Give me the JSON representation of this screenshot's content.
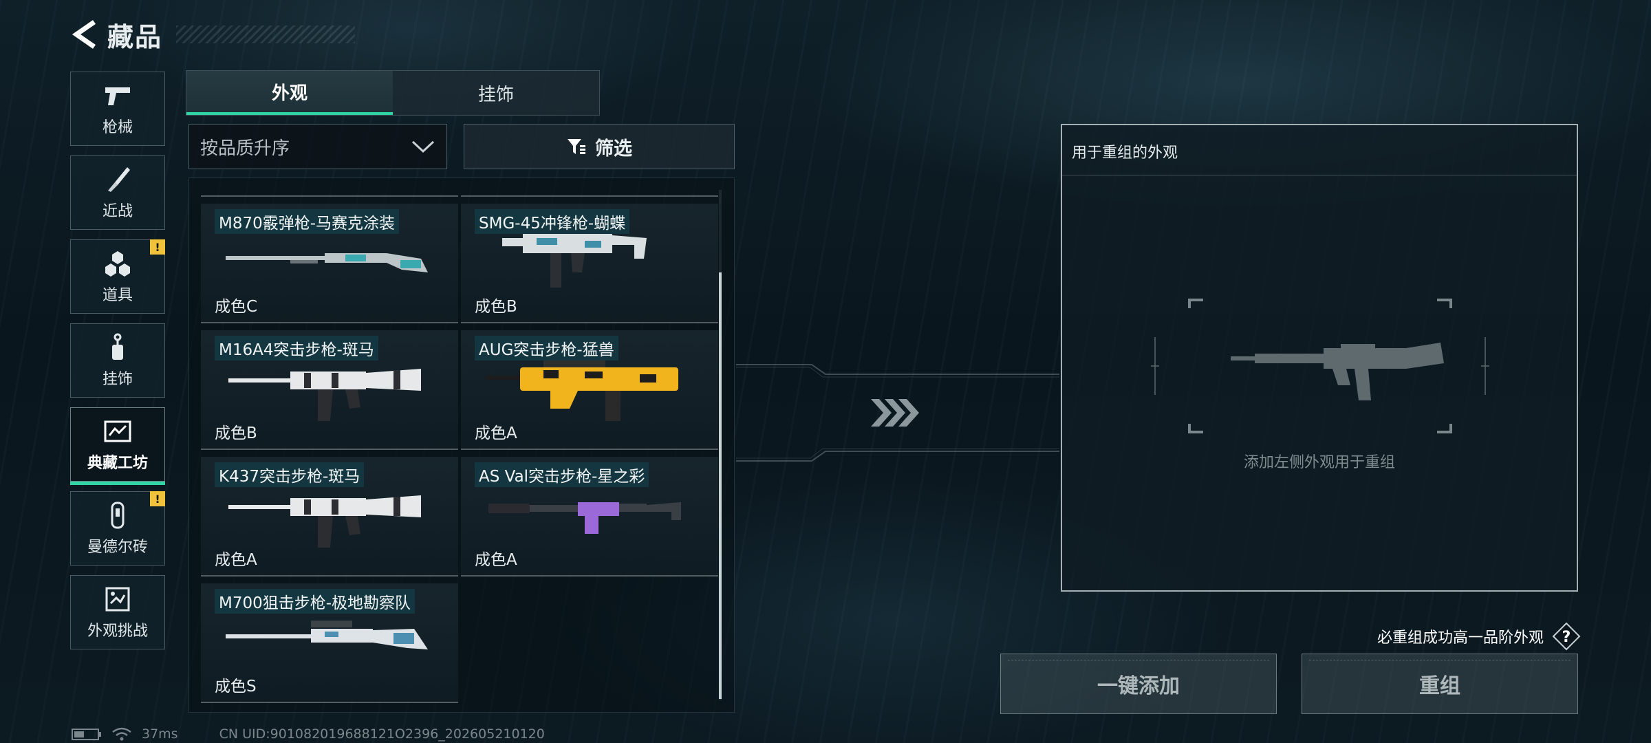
{
  "header": {
    "title": "藏品"
  },
  "nav": {
    "items": [
      {
        "label": "枪械",
        "icon": "pistol-icon",
        "badge": ""
      },
      {
        "label": "近战",
        "icon": "knife-icon",
        "badge": ""
      },
      {
        "label": "道具",
        "icon": "grenade-icon",
        "badge": "!"
      },
      {
        "label": "挂饰",
        "icon": "charm-icon",
        "badge": ""
      },
      {
        "label": "典藏工坊",
        "icon": "workshop-icon",
        "badge": ""
      },
      {
        "label": "曼德尔砖",
        "icon": "brick-icon",
        "badge": "!"
      },
      {
        "label": "外观挑战",
        "icon": "challenge-icon",
        "badge": ""
      }
    ],
    "active_index": 4
  },
  "tabs": [
    {
      "label": "外观"
    },
    {
      "label": "挂饰"
    }
  ],
  "sort": {
    "label": "按品质升序"
  },
  "filter": {
    "label": "筛选"
  },
  "items": [
    {
      "name": "M870霰弹枪-马赛克涂装",
      "grade": "成色C",
      "skin": "shotgun",
      "colors": [
        "#bcc6c9",
        "#3aa9b0"
      ]
    },
    {
      "name": "SMG-45冲锋枪-蝴蝶",
      "grade": "成色B",
      "skin": "smg",
      "colors": [
        "#d9dfe1",
        "#3f8fa8"
      ]
    },
    {
      "name": "M16A4突击步枪-斑马",
      "grade": "成色B",
      "skin": "rifle",
      "colors": [
        "#e6e8e9",
        "#2b2d30"
      ]
    },
    {
      "name": "AUG突击步枪-猛兽",
      "grade": "成色A",
      "skin": "bullpup",
      "colors": [
        "#f2b41c",
        "#1d1d1d"
      ]
    },
    {
      "name": "K437突击步枪-斑马",
      "grade": "成色A",
      "skin": "rifle",
      "colors": [
        "#e6e8e9",
        "#2b2d30"
      ]
    },
    {
      "name": "AS Val突击步枪-星之彩",
      "grade": "成色A",
      "skin": "asval",
      "colors": [
        "#9c6ad8",
        "#2a2a30"
      ]
    },
    {
      "name": "M700狙击步枪-极地勘察队",
      "grade": "成色S",
      "skin": "sniper",
      "colors": [
        "#dde3e6",
        "#4c8fb0"
      ]
    }
  ],
  "remix": {
    "title": "用于重组的外观",
    "hint": "添加左侧外观用于重组",
    "info": "必重组成功高一品阶外观",
    "quick_add_label": "一键添加",
    "remix_label": "重组"
  },
  "status": {
    "ping": "37ms",
    "uid": "CN UID:901082019688121O2396_202605210120"
  },
  "colors": {
    "accent": "#2fd6a4",
    "warning": "#f0c23a"
  }
}
